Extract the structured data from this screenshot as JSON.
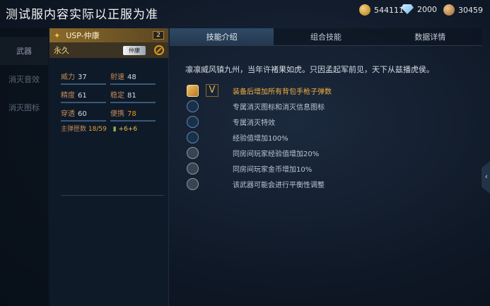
{
  "banner": "测试服内容实际以正服为准",
  "currency": [
    {
      "icon": "gold-coin-icon",
      "value": "544111"
    },
    {
      "icon": "diamond-icon",
      "value": "2000"
    },
    {
      "icon": "bronze-coin-icon",
      "value": "30459"
    }
  ],
  "left_nav": [
    {
      "label": "武器"
    },
    {
      "label": "消灭音效"
    },
    {
      "label": "消灭图标"
    }
  ],
  "weapon": {
    "name": "USP-仲康",
    "level": "2",
    "duration": "永久",
    "tag": "仲康",
    "stats": [
      {
        "label": "威力",
        "value": "37"
      },
      {
        "label": "射速",
        "value": "48"
      },
      {
        "label": "精度",
        "value": "61"
      },
      {
        "label": "稳定",
        "value": "81"
      },
      {
        "label": "穿透",
        "value": "60"
      },
      {
        "label": "便携",
        "value": "78"
      }
    ],
    "ammo_label": "主弹匣数",
    "ammo_value": "18/59",
    "ammo_bonus": "+6+6"
  },
  "tabs": [
    "技能介绍",
    "组合技能",
    "数据详情"
  ],
  "description": "凛凛威风镇九州，当年许褚果如虎。只因孟起军前见，天下从兹播虎侯。",
  "skills": [
    {
      "text": "装备后增加所有背包手枪子弹数",
      "badge": "V"
    },
    {
      "text": "专属消灭图标和消灭信息图标"
    },
    {
      "text": "专属消灭特效"
    },
    {
      "text": "经验值增加100%"
    },
    {
      "text": "同房间玩家经验值增加20%"
    },
    {
      "text": "同房间玩家金币增加10%"
    },
    {
      "text": "该武器可能会进行平衡性调整"
    }
  ],
  "side_arrow": "‹",
  "colors": {
    "accent_gold": "#f0b03c",
    "tab_active": "#2f4a66",
    "stat_label": "#c48a58"
  }
}
